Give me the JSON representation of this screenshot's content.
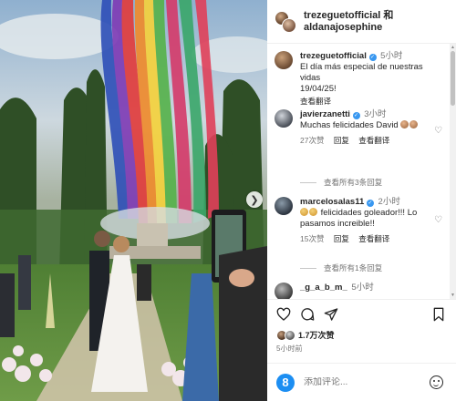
{
  "photo": {
    "alt_next": "next"
  },
  "header": {
    "title_line1": "trezeguetofficial 和",
    "title_line2": "aldanajosephine"
  },
  "comments": [
    {
      "user": "trezeguetofficial",
      "time": "5小时",
      "text_line1": "El día más especial de nuestras vidas",
      "text_line2": "19/04/25!",
      "translate": "查看翻译"
    },
    {
      "user": "javierzanetti",
      "time": "3小时",
      "text": "Muchas felicidades David",
      "likes": "27次赞",
      "reply": "回复",
      "translate": "查看翻译",
      "view_replies": "查看所有3条回复"
    },
    {
      "user": "marcelosalas11",
      "time": "2小时",
      "text_line1": "felicidades goleador!!! Lo",
      "text_line2": "pasamos increible!!",
      "likes": "15次赞",
      "reply": "回复",
      "translate": "查看翻译",
      "view_replies": "查看所有1条回复"
    },
    {
      "user": "_g_a_b_m_",
      "time": "5小时"
    }
  ],
  "actions": {
    "likes_count": "1.7万次赞",
    "posted_ago": "5小时前"
  },
  "add_comment": {
    "avatar_letter": "8",
    "placeholder": "添加评论..."
  },
  "icons": {
    "heart": "heart-icon",
    "comment": "comment-icon",
    "share": "share-icon",
    "save": "bookmark-icon",
    "emoji": "emoji-icon",
    "next": "chevron-right-icon"
  },
  "colors": {
    "verified": "#3897f0",
    "muted": "#737373",
    "text": "#262626"
  }
}
